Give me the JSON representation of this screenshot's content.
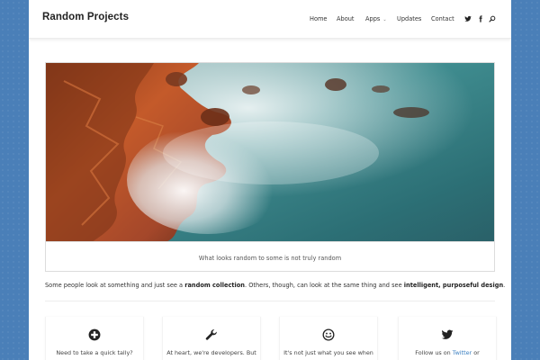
{
  "site": {
    "title": "Random Projects"
  },
  "nav": {
    "items": [
      {
        "label": "Home"
      },
      {
        "label": "About"
      },
      {
        "label": "Apps"
      },
      {
        "label": "Updates"
      },
      {
        "label": "Contact"
      }
    ]
  },
  "header_icons": [
    "twitter-icon",
    "facebook-icon",
    "search-icon"
  ],
  "hero": {
    "caption": "What looks random to some is not truly random"
  },
  "intro": {
    "part1": "Some people look at something and just see a ",
    "bold1": "random collection",
    "part2": ". Others, though, can look at the same thing and see ",
    "bold2": "intelligent, purposeful design",
    "part3": "."
  },
  "features": [
    {
      "icon": "plus-circle-icon",
      "text": "Need to take a quick tally?"
    },
    {
      "icon": "wrench-icon",
      "text": "At heart, we're developers. But"
    },
    {
      "icon": "smiley-icon",
      "text": "It's not just what you see when"
    },
    {
      "icon": "twitter-icon",
      "text_prefix": "Follow us on ",
      "link": "Twitter",
      "text_suffix": " or"
    }
  ],
  "colors": {
    "background": "#4a7fb8",
    "link": "#3a7fc1"
  }
}
